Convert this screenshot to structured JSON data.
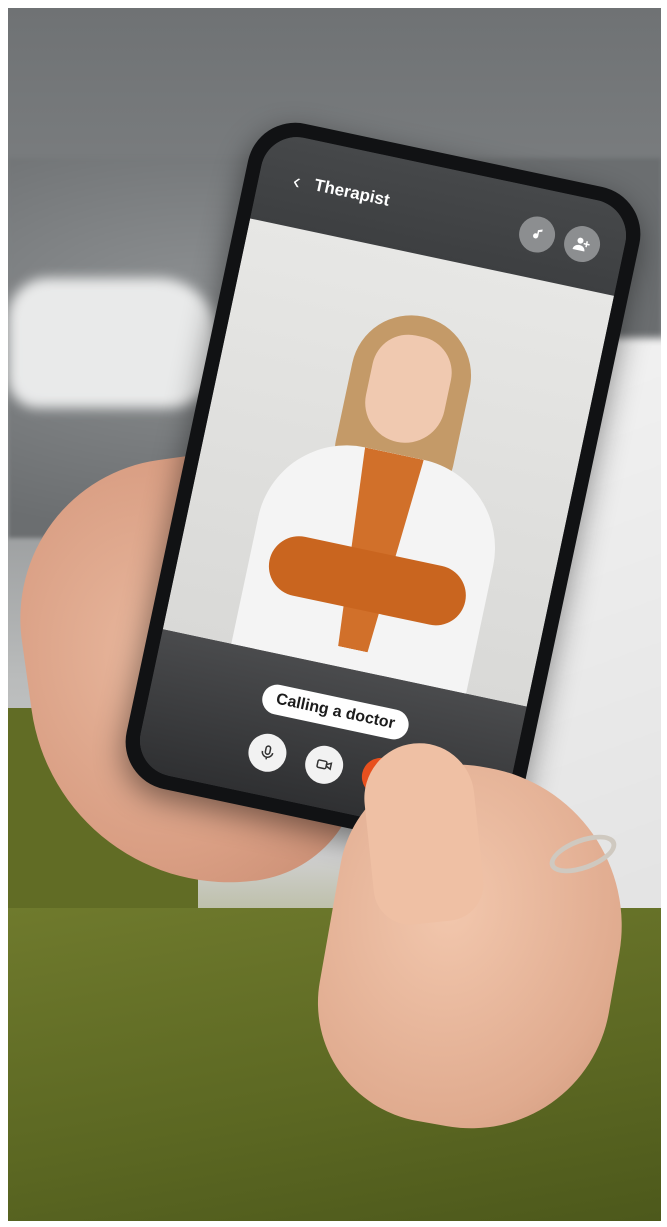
{
  "call": {
    "contact_title": "Therapist",
    "status_text": "Calling a doctor"
  },
  "icons": {
    "back": "chevron-left-icon",
    "note": "music-note-icon",
    "add_user": "add-user-icon",
    "mic": "microphone-icon",
    "video": "video-camera-icon",
    "end_call": "phone-hangup-icon"
  },
  "colors": {
    "end_call_accent": "#e8501e",
    "pill_bg": "#ffffff"
  }
}
